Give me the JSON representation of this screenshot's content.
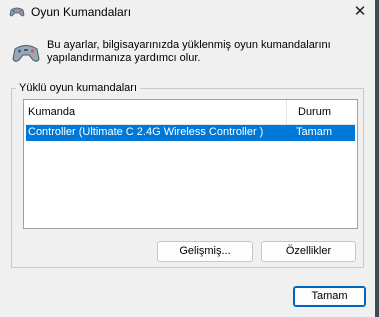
{
  "window": {
    "title": "Oyun Kumandaları",
    "close_symbol": "✕"
  },
  "description": "Bu ayarlar, bilgisayarınızda yüklenmiş oyun kumandalarını yapılandırmanıza yardımcı olur.",
  "group": {
    "label": "Yüklü oyun kumandaları",
    "columns": {
      "name": "Kumanda",
      "status": "Durum"
    },
    "rows": [
      {
        "name": "Controller (Ultimate C 2.4G Wireless Controller )",
        "status": "Tamam",
        "selected": true
      }
    ]
  },
  "buttons": {
    "advanced": "Gelişmiş...",
    "properties": "Özellikler",
    "ok": "Tamam"
  },
  "icons": {
    "title_icon": "gamepad-icon",
    "dialog_icon": "gamepad-icon"
  },
  "colors": {
    "selection": "#0078d7",
    "accent_border": "#0067c0"
  }
}
